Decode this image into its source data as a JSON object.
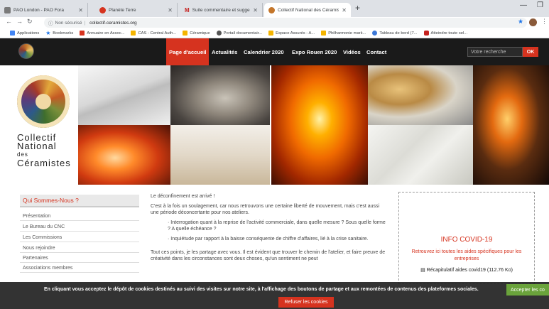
{
  "browser": {
    "tabs": [
      {
        "title": "PAO London - PAO Fora",
        "color": "#7a7a7a"
      },
      {
        "title": "Planète Terre",
        "color": "#d6331f"
      },
      {
        "title": "Suite commentaire et suggestio",
        "color": "#c5221f"
      },
      {
        "title": "Collectif National des Céramistes",
        "color": "#c4762b"
      }
    ],
    "new_tab": "+",
    "security": "Non sécurisé",
    "url": "collectif-ceramistes.org",
    "bookmarks": [
      {
        "label": "Applications",
        "color": "#4285f4"
      },
      {
        "label": "Bookmarks",
        "color": "#1a73e8"
      },
      {
        "label": "Annuaire en Assoc...",
        "color": "#d6331f"
      },
      {
        "label": "CAS - Central Auth...",
        "color": "#f4b400"
      },
      {
        "label": "Céramique",
        "color": "#f4b400"
      },
      {
        "label": "Portail documentair...",
        "color": "#555555"
      },
      {
        "label": "Espace Assurés - A...",
        "color": "#f4b400"
      },
      {
        "label": "Philharmonie mark...",
        "color": "#f4b400"
      },
      {
        "label": "Tableau de bord (7...",
        "color": "#3c78d8"
      },
      {
        "label": "Atteindre toute sel...",
        "color": "#c5221f"
      }
    ]
  },
  "site": {
    "nav": [
      {
        "label": "Page d'accueil",
        "active": true
      },
      {
        "label": "Actualités",
        "active": false
      },
      {
        "label": "Calendrier 2020",
        "active": false
      },
      {
        "label": "Expo Rouen 2020",
        "active": false
      },
      {
        "label": "Vidéos",
        "active": false
      },
      {
        "label": "Contact",
        "active": false
      }
    ],
    "search_placeholder": "Votre recherche",
    "search_button": "OK",
    "logo": {
      "line1": "Collectif",
      "line2": "National",
      "line3": "des",
      "line4": "Céramistes"
    }
  },
  "sidebar": {
    "title": "Qui Sommes-Nous ?",
    "items": [
      "Présentation",
      "Le Bureau du CNC",
      "Les Commissions",
      "Nous rejoindre",
      "Partenaires",
      "Associations membres"
    ]
  },
  "article": {
    "p1": "Le déconfinement est arrivé !",
    "p2": "C'est à la fois un soulagement, car nous retrouvons une certaine liberté de mouvement, mais c'est aussi une période déconcertante pour nos ateliers.",
    "b1": "Interrogation quant à la reprise de l'activité commerciale, dans quelle mesure ? Sous quelle forme ? A quelle échéance ?",
    "b2": "Inquiétude par rapport à la baisse conséquente de chiffre d'affaires, lié à la crise sanitaire.",
    "p3": "Tout ces points, je les partage avec vous. Il est évident que trouver le chemin de l'atelier, et faire preuve de créativité dans les circonstances sont deux choses, qu'un sentiment ne peut"
  },
  "covid": {
    "title": "INFO COVID-19",
    "desc": "Retrouvez ici toutes les aides spécifiques pour les entreprises",
    "file": "Récapitulatif aides covid19 (112.76 Ko)"
  },
  "cookie": {
    "text": "En cliquant vous acceptez le dépôt de cookies destinés au suivi des visites sur notre site, à l'affichage des boutons de partage et aux remontées de contenus des plateformes sociales.",
    "accept": "Accepter les co",
    "refuse": "Refuser les cookies"
  },
  "colors": {
    "accent": "#d6331f",
    "accept": "#6aa33b",
    "nav_bg": "#1a1a1a"
  }
}
